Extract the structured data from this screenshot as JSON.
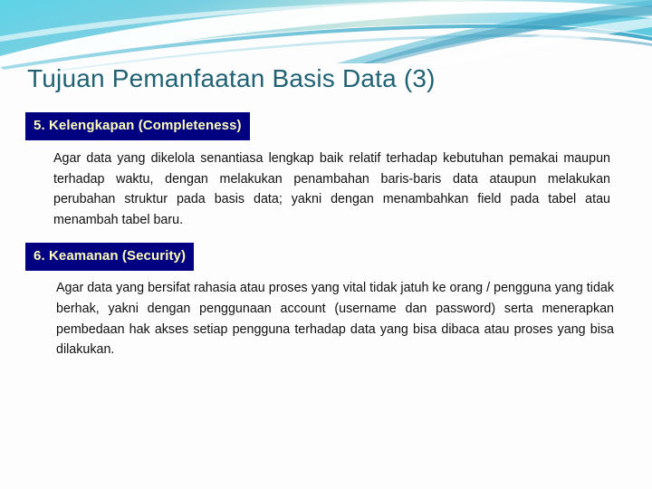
{
  "slide": {
    "title": "Tujuan Pemanfaatan Basis Data (3)",
    "title_color": "#1f6274",
    "background_color": "#fdfdfd",
    "banner": {
      "name": "teal-swoosh-banner",
      "colors": {
        "cyan": "#62d8e8",
        "light_cyan": "#a7e6f0",
        "mid_teal": "#6ec6dd",
        "pale_green": "#d5eedf",
        "deep_teal": "#1f8ca8",
        "white": "#ffffff"
      }
    },
    "sections": [
      {
        "id": "completeness",
        "heading": "5. Kelengkapan (Completeness)",
        "heading_bg": "#000080",
        "heading_color": "#ffffbb",
        "body": "Agar data yang dikelola senantiasa lengkap baik relatif terhadap kebutuhan pemakai maupun terhadap waktu, dengan melakukan penambahan baris-baris data ataupun melakukan perubahan struktur pada basis data; yakni dengan menambahkan field pada tabel atau menambah tabel baru."
      },
      {
        "id": "security",
        "heading": "6. Keamanan (Security)",
        "heading_bg": "#000080",
        "heading_color": "#ffffbb",
        "body": "Agar data yang bersifat rahasia atau proses yang vital tidak jatuh ke orang / pengguna yang tidak berhak, yakni dengan penggunaan account (username dan password) serta menerapkan pembedaan hak akses setiap pengguna terhadap data yang bisa dibaca atau proses yang bisa dilakukan."
      }
    ]
  }
}
